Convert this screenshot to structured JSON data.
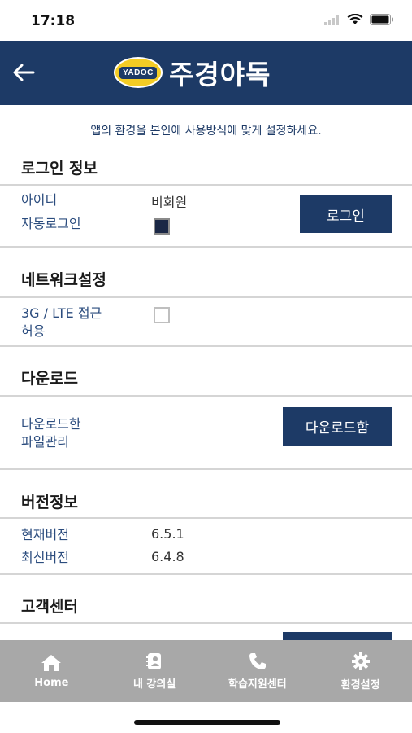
{
  "status": {
    "time": "17:18"
  },
  "header": {
    "logo_badge": "YADOC",
    "title": "주경야독"
  },
  "intro_text": "앱의 환경을 본인에 사용방식에 맞게 설정하세요.",
  "login": {
    "title": "로그인 정보",
    "id_label": "아이디",
    "id_value": "비회원",
    "auto_login_label": "자동로그인",
    "auto_login_checked": true,
    "button": "로그인"
  },
  "network": {
    "title": "네트워크설정",
    "lte_label_line1": "3G / LTE 접근",
    "lte_label_line2": "허용",
    "lte_checked": false
  },
  "download": {
    "title": "다운로드",
    "manage_label_line1": "다운로드한",
    "manage_label_line2": "파일관리",
    "button": "다운로드함"
  },
  "version": {
    "title": "버전정보",
    "current_label": "현재버전",
    "current_value": "6.5.1",
    "latest_label": "최신버전",
    "latest_value": "6.4.8"
  },
  "support": {
    "title": "고객센터"
  },
  "tabs": [
    {
      "label": "Home",
      "icon": "home-icon"
    },
    {
      "label": "내 강의실",
      "icon": "classroom-icon"
    },
    {
      "label": "학습지원센터",
      "icon": "phone-icon"
    },
    {
      "label": "환경설정",
      "icon": "gear-icon"
    }
  ],
  "colors": {
    "primary": "#1d3a66",
    "tabbar": "#a8a8a8",
    "label": "#2b4c7e"
  }
}
